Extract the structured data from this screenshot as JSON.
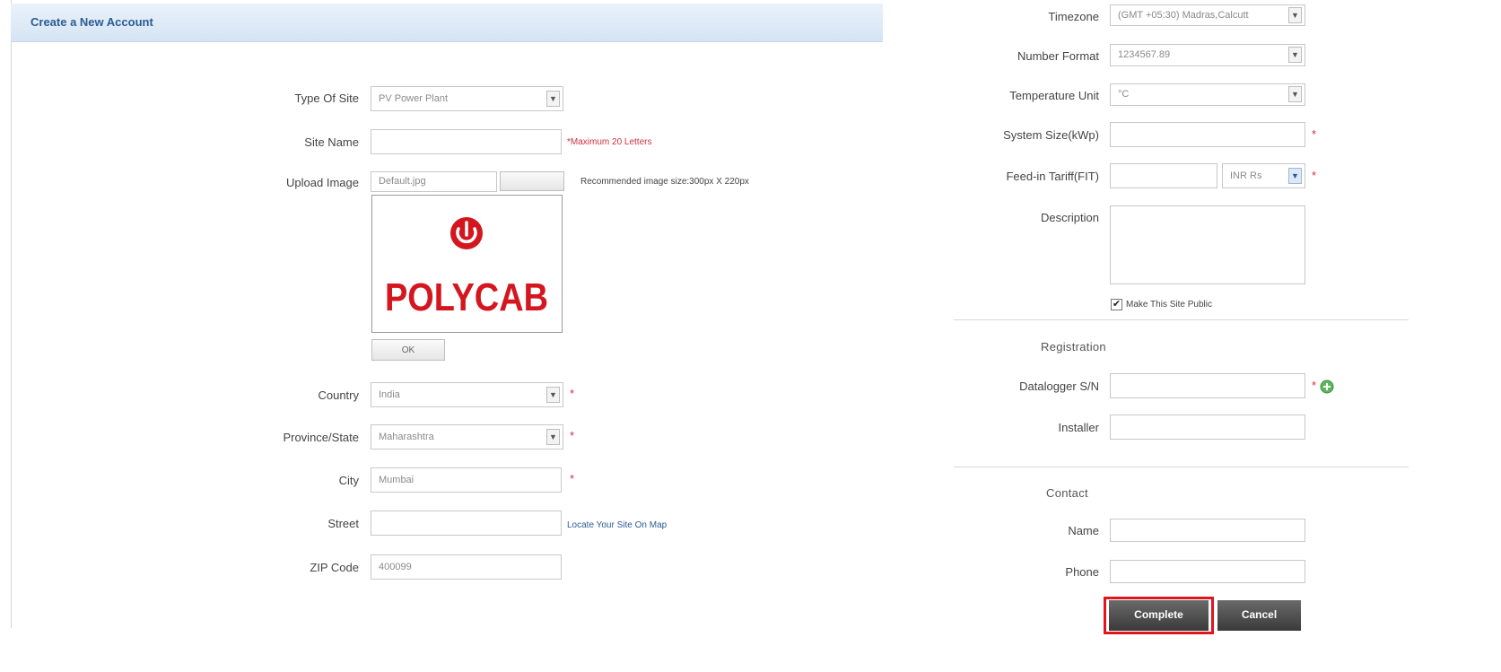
{
  "header": {
    "title": "Create a New Account"
  },
  "left_form": {
    "type_of_site": {
      "label": "Type Of Site",
      "value": "PV Power Plant"
    },
    "site_name": {
      "label": "Site Name",
      "value": "",
      "hint": "*Maximum 20 Letters"
    },
    "upload_image": {
      "label": "Upload Image",
      "file_value": "Default.jpg",
      "browse_label": "",
      "hint": "Recommended image size:300px X 220px"
    },
    "logo": {
      "word": "POLYCAB"
    },
    "ok_button": {
      "label": "OK"
    },
    "country": {
      "label": "Country",
      "value": "India",
      "required": "*"
    },
    "province": {
      "label": "Province/State",
      "value": "Maharashtra",
      "required": "*"
    },
    "city": {
      "label": "City",
      "value": "Mumbai",
      "required": "*"
    },
    "street": {
      "label": "Street",
      "value": "",
      "hint": "Locate Your Site On Map"
    },
    "zip": {
      "label": "ZIP Code",
      "value": "400099"
    }
  },
  "right_form": {
    "timezone": {
      "label": "Timezone",
      "value": "(GMT +05:30) Madras,Calcutt"
    },
    "number_format": {
      "label": "Number Format",
      "value": "1234567.89"
    },
    "temperature_unit": {
      "label": "Temperature Unit",
      "value": "°C"
    },
    "system_size": {
      "label": "System Size(kWp)",
      "value": "",
      "required": "*"
    },
    "feed_in_tariff": {
      "label": "Feed-in Tariff(FIT)",
      "value": "",
      "currency": "INR Rs",
      "required": "*"
    },
    "description": {
      "label": "Description",
      "value": ""
    },
    "make_public": {
      "label": "Make This Site Public",
      "checked": true
    }
  },
  "registration": {
    "heading": "Registration",
    "datalogger": {
      "label": "Datalogger S/N",
      "value": "",
      "required": "*"
    },
    "installer": {
      "label": "Installer",
      "value": ""
    }
  },
  "contact": {
    "heading": "Contact",
    "name": {
      "label": "Name",
      "value": ""
    },
    "phone": {
      "label": "Phone",
      "value": ""
    }
  },
  "actions": {
    "complete_label": "Complete",
    "cancel_label": "Cancel"
  },
  "colors": {
    "accent": "#2b5c94",
    "required": "#d0303d",
    "logo_red": "#d4161f",
    "highlight": "#e0151d"
  },
  "icons": {
    "add": "plus-circle-icon",
    "power": "power-icon",
    "dropdown": "chevron-down-icon",
    "checkbox": "checkmark-icon"
  }
}
